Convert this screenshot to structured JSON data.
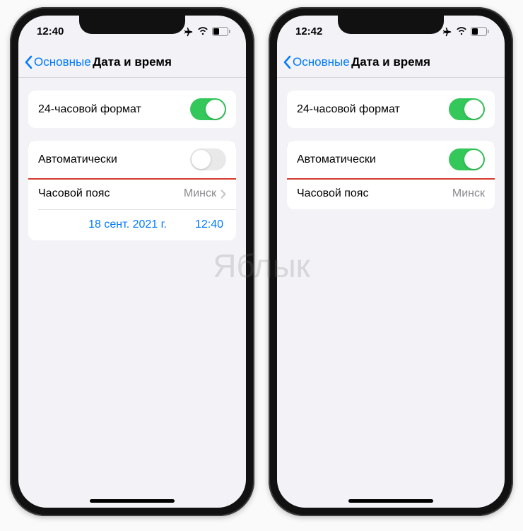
{
  "watermark": "Яблык",
  "phones": [
    {
      "status_time": "12:40",
      "back_label": "Основные",
      "title": "Дата и время",
      "twenty_four_label": "24-часовой формат",
      "twenty_four_on": true,
      "auto_label": "Автоматически",
      "auto_on": false,
      "timezone_label": "Часовой пояс",
      "timezone_value": "Минск",
      "timezone_chevron": true,
      "show_datetime_row": true,
      "date_value": "18 сент. 2021 г.",
      "time_value": "12:40"
    },
    {
      "status_time": "12:42",
      "back_label": "Основные",
      "title": "Дата и время",
      "twenty_four_label": "24-часовой формат",
      "twenty_four_on": true,
      "auto_label": "Автоматически",
      "auto_on": true,
      "timezone_label": "Часовой пояс",
      "timezone_value": "Минск",
      "timezone_chevron": false,
      "show_datetime_row": false
    }
  ]
}
